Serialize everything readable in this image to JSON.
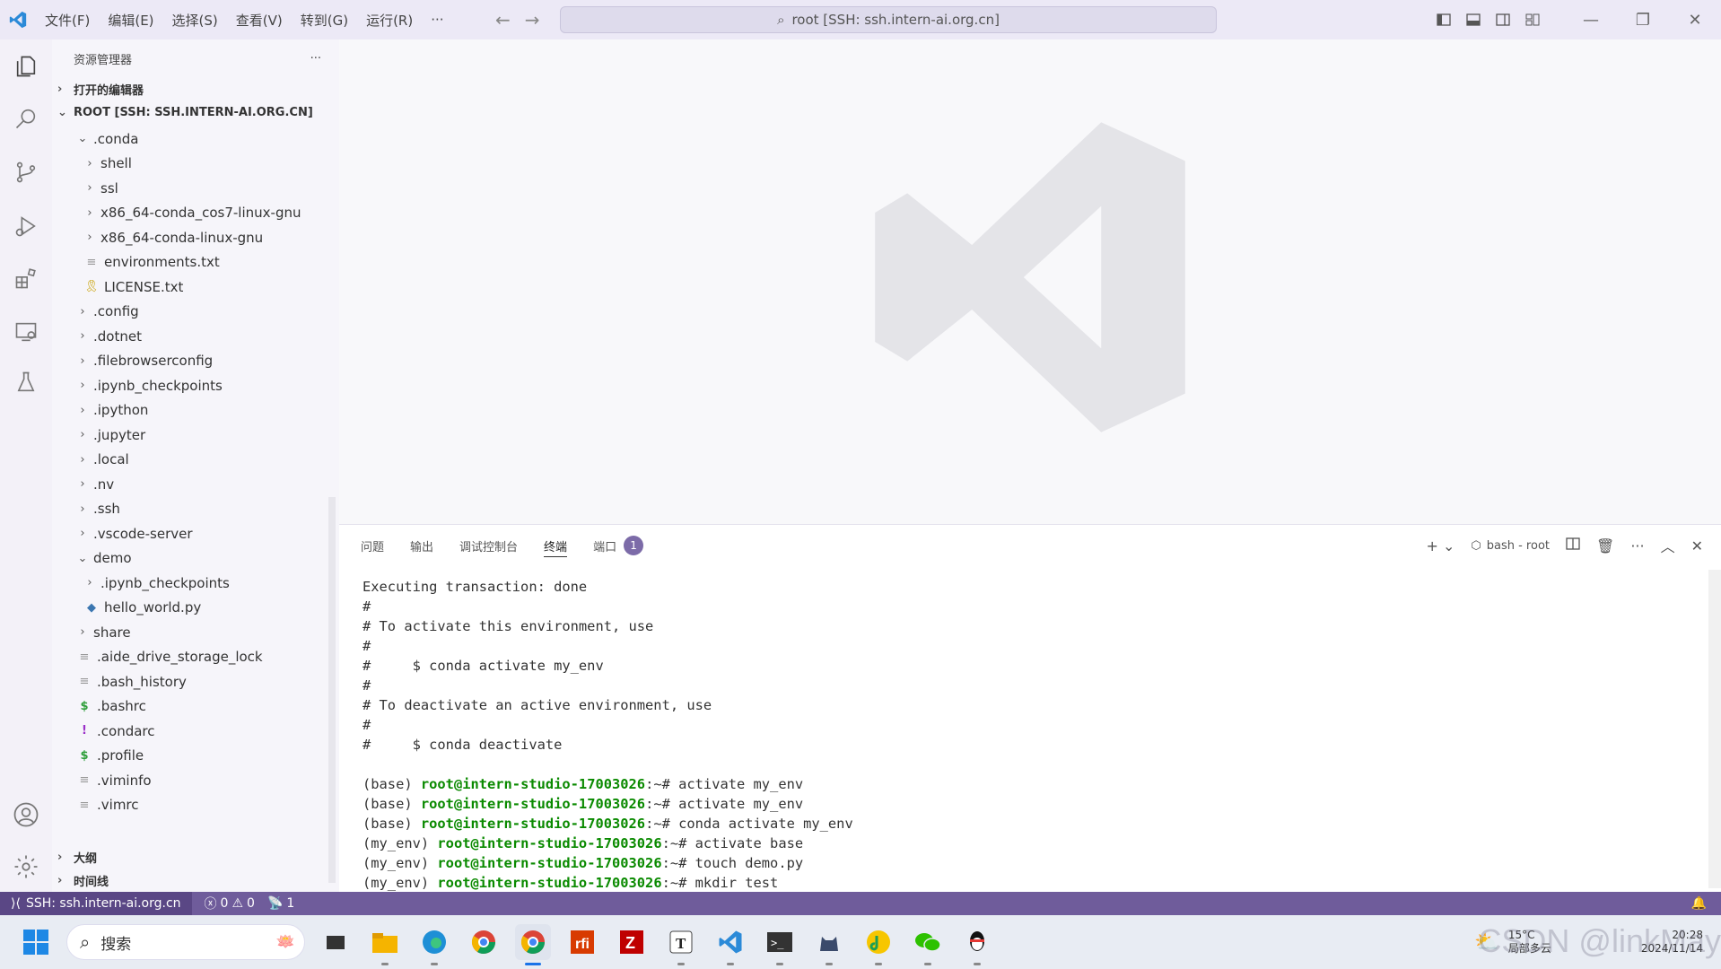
{
  "titlebar": {
    "menus": [
      "文件(F)",
      "编辑(E)",
      "选择(S)",
      "查看(V)",
      "转到(G)",
      "运行(R)",
      "···"
    ],
    "command_center": "root [SSH: ssh.intern-ai.org.cn]"
  },
  "sidebar": {
    "title": "资源管理器",
    "more": "···",
    "open_editors": "打开的编辑器",
    "root": "ROOT [SSH: SSH.INTERN-AI.ORG.CN]",
    "tree": [
      {
        "label": ".conda",
        "depth": 1,
        "kind": "folder-open"
      },
      {
        "label": "shell",
        "depth": 2,
        "kind": "folder"
      },
      {
        "label": "ssl",
        "depth": 2,
        "kind": "folder"
      },
      {
        "label": "x86_64-conda_cos7-linux-gnu",
        "depth": 2,
        "kind": "folder"
      },
      {
        "label": "x86_64-conda-linux-gnu",
        "depth": 2,
        "kind": "folder"
      },
      {
        "label": "environments.txt",
        "depth": 2,
        "kind": "file-lines"
      },
      {
        "label": "LICENSE.txt",
        "depth": 2,
        "kind": "file-license"
      },
      {
        "label": ".config",
        "depth": 1,
        "kind": "folder"
      },
      {
        "label": ".dotnet",
        "depth": 1,
        "kind": "folder"
      },
      {
        "label": ".filebrowserconfig",
        "depth": 1,
        "kind": "folder"
      },
      {
        "label": ".ipynb_checkpoints",
        "depth": 1,
        "kind": "folder"
      },
      {
        "label": ".ipython",
        "depth": 1,
        "kind": "folder"
      },
      {
        "label": ".jupyter",
        "depth": 1,
        "kind": "folder"
      },
      {
        "label": ".local",
        "depth": 1,
        "kind": "folder"
      },
      {
        "label": ".nv",
        "depth": 1,
        "kind": "folder"
      },
      {
        "label": ".ssh",
        "depth": 1,
        "kind": "folder"
      },
      {
        "label": ".vscode-server",
        "depth": 1,
        "kind": "folder"
      },
      {
        "label": "demo",
        "depth": 1,
        "kind": "folder-open"
      },
      {
        "label": ".ipynb_checkpoints",
        "depth": 2,
        "kind": "folder"
      },
      {
        "label": "hello_world.py",
        "depth": 2,
        "kind": "file-python"
      },
      {
        "label": "share",
        "depth": 1,
        "kind": "folder"
      },
      {
        "label": ".aide_drive_storage_lock",
        "depth": 1,
        "kind": "file-lines"
      },
      {
        "label": ".bash_history",
        "depth": 1,
        "kind": "file-lines"
      },
      {
        "label": ".bashrc",
        "depth": 1,
        "kind": "file-shell"
      },
      {
        "label": ".condarc",
        "depth": 1,
        "kind": "file-yaml"
      },
      {
        "label": ".profile",
        "depth": 1,
        "kind": "file-shell"
      },
      {
        "label": ".viminfo",
        "depth": 1,
        "kind": "file-lines"
      },
      {
        "label": ".vimrc",
        "depth": 1,
        "kind": "file-lines"
      }
    ],
    "outline": "大纲",
    "timeline": "时间线"
  },
  "panel": {
    "tabs": [
      "问题",
      "输出",
      "调试控制台",
      "终端",
      "端口"
    ],
    "active_tab": "终端",
    "ports_badge": "1",
    "terminal_name": "bash - root"
  },
  "terminal": {
    "lines": [
      {
        "text": "Executing transaction: done"
      },
      {
        "text": "#"
      },
      {
        "text": "# To activate this environment, use"
      },
      {
        "text": "#"
      },
      {
        "text": "#     $ conda activate my_env"
      },
      {
        "text": "#"
      },
      {
        "text": "# To deactivate an active environment, use"
      },
      {
        "text": "#"
      },
      {
        "text": "#     $ conda deactivate"
      },
      {
        "text": ""
      },
      {
        "env": "(base) ",
        "host": "root@intern-studio-17003026",
        "cmd": ":~# activate my_env"
      },
      {
        "env": "(base) ",
        "host": "root@intern-studio-17003026",
        "cmd": ":~# activate my_env"
      },
      {
        "env": "(base) ",
        "host": "root@intern-studio-17003026",
        "cmd": ":~# conda activate my_env"
      },
      {
        "env": "(my_env) ",
        "host": "root@intern-studio-17003026",
        "cmd": ":~# activate base"
      },
      {
        "env": "(my_env) ",
        "host": "root@intern-studio-17003026",
        "cmd": ":~# touch demo.py"
      },
      {
        "env": "(my_env) ",
        "host": "root@intern-studio-17003026",
        "cmd": ":~# mkdir test"
      }
    ]
  },
  "status": {
    "remote": "SSH: ssh.intern-ai.org.cn",
    "errors": "0",
    "warnings": "0",
    "ports": "1"
  },
  "taskbar": {
    "search_placeholder": "搜索",
    "weather_temp": "15°C",
    "weather_desc": "局部多云",
    "time": "20:28",
    "date": "2024/11/14",
    "watermark": "CSDN @linkMay"
  },
  "colors": {
    "accent": "#6f5c9b",
    "terminal_host": "#0a8a00",
    "badge": "#7c6ba8"
  }
}
